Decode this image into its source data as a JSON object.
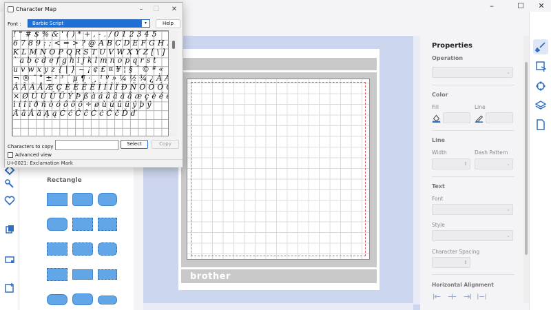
{
  "app": {
    "window_controls": {
      "minimize": "–",
      "maximize": "☐",
      "close": "✕"
    },
    "shape_panel": {
      "heading": "Rectangle"
    },
    "canvas": {
      "brand_text": "brother"
    },
    "properties": {
      "title": "Properties",
      "operation": {
        "label": "Operation"
      },
      "color": {
        "label": "Color",
        "fill_label": "Fill",
        "line_label": "Line"
      },
      "line": {
        "label": "Line",
        "width_label": "Width",
        "dash_label": "Dash Pattern"
      },
      "text": {
        "label": "Text",
        "font_label": "Font",
        "style_label": "Style",
        "spacing_label": "Character Spacing"
      },
      "align": {
        "label": "Horizontal Alignment"
      }
    },
    "colors": {
      "shape_fill": "#62a6e8",
      "canvas_bg": "#cdd6ef",
      "mat_gray": "#c9c9c9",
      "cut_line": "#e06060"
    }
  },
  "charmap": {
    "title": "Character Map",
    "window_controls": {
      "minimize": "–",
      "maximize": "☐",
      "close": "✕"
    },
    "font_label": "Font :",
    "font_value": "Barbie Script",
    "help_label": "Help",
    "glyph_rows": [
      "!\"#$%&'()*+,-./012345",
      "6789:;<=>?@ABCDEFGHIJ",
      "KLMNOPQRSTUVWXYZ[\\]^_",
      "`abcdefghijklmnopqrst",
      "uvwxyz{|}~¡¢£¤¥¦§¨©ª«",
      "¬®¯°±²³´µ¶·¸¹º»¼½¾¿ÀÁ",
      "ÂÃÄÅÆÇÈÉÊËÌÍÎÏÐÑÒÓÔÕÖ",
      "×ØÙÚÛÜÝÞßàáâãäåæçèéêë",
      "ìíîïðñòóôõö÷øùúûüýþÿ",
      "ĀāĂăĄąĆćĈĉĊċČčĎď"
    ],
    "copy_label": "Characters to copy :",
    "copy_value": "",
    "select_label": "Select",
    "copy_button_label": "Copy",
    "advanced_label": "Advanced view",
    "status_text": "U+0021: Exclamation Mark"
  }
}
